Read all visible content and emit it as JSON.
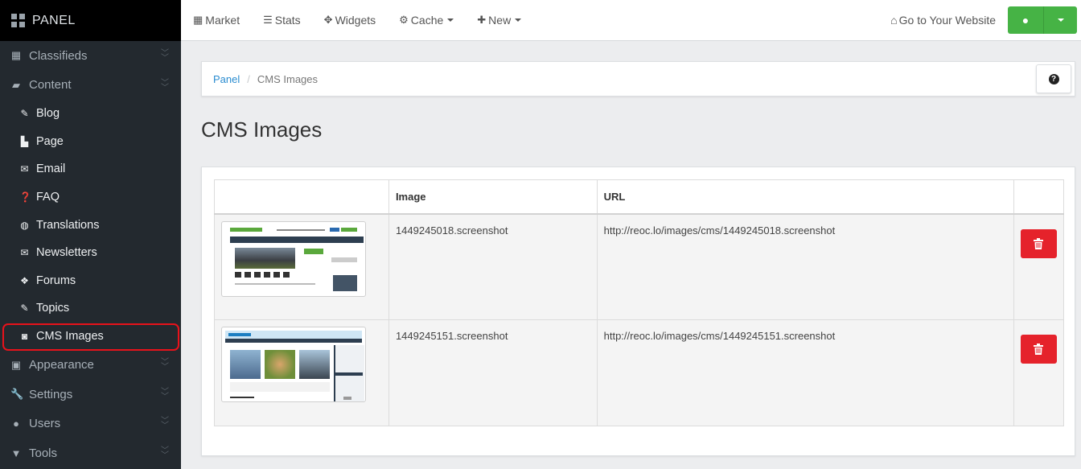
{
  "brand": {
    "label": "PANEL"
  },
  "sidebar": {
    "groups_top": [
      {
        "label": "Classifieds",
        "icon": "grid-icon"
      },
      {
        "label": "Content",
        "icon": "folder-open-icon"
      }
    ],
    "content_items": [
      {
        "label": "Blog",
        "icon": "pencil-icon"
      },
      {
        "label": "Page",
        "icon": "file-icon"
      },
      {
        "label": "Email",
        "icon": "envelope-icon"
      },
      {
        "label": "FAQ",
        "icon": "question-circle-icon"
      },
      {
        "label": "Translations",
        "icon": "globe-icon"
      },
      {
        "label": "Newsletters",
        "icon": "envelope-icon"
      },
      {
        "label": "Forums",
        "icon": "tags-icon"
      },
      {
        "label": "Topics",
        "icon": "pencil-icon"
      },
      {
        "label": "CMS Images",
        "icon": "camera-icon",
        "active": true
      }
    ],
    "groups_bottom": [
      {
        "label": "Appearance",
        "icon": "picture-icon"
      },
      {
        "label": "Settings",
        "icon": "wrench-icon"
      },
      {
        "label": "Users",
        "icon": "user-icon"
      },
      {
        "label": "Tools",
        "icon": "filter-icon"
      }
    ]
  },
  "topbar": {
    "market": "Market",
    "stats": "Stats",
    "widgets": "Widgets",
    "cache": "Cache",
    "new": "New",
    "goto": "Go to Your Website"
  },
  "breadcrumb": {
    "root": "Panel",
    "current": "CMS Images"
  },
  "page": {
    "title": "CMS Images"
  },
  "table": {
    "headers": [
      "",
      "Image",
      "URL",
      ""
    ],
    "rows": [
      {
        "image": "1449245018.screenshot",
        "url": "http://reoc.lo/images/cms/1449245018.screenshot"
      },
      {
        "image": "1449245151.screenshot",
        "url": "http://reoc.lo/images/cms/1449245151.screenshot"
      }
    ]
  },
  "colors": {
    "sidebar_bg": "#23292f",
    "accent_green": "#46b345",
    "danger": "#e5222b",
    "link": "#2a8cd0",
    "highlight": "#e8121b"
  }
}
